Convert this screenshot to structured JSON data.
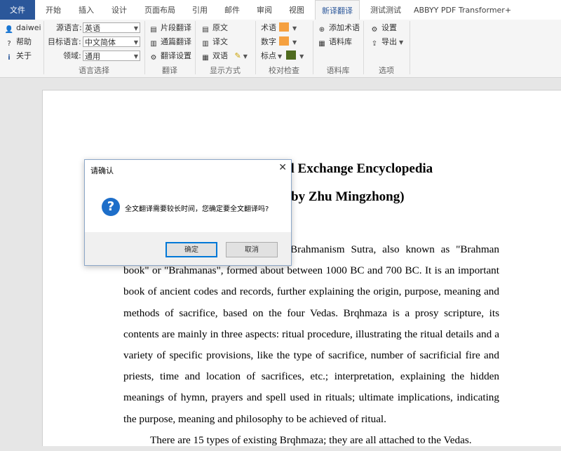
{
  "tabs": [
    {
      "label": "文件",
      "type": "file"
    },
    {
      "label": "开始"
    },
    {
      "label": "插入"
    },
    {
      "label": "设计"
    },
    {
      "label": "页面布局"
    },
    {
      "label": "引用"
    },
    {
      "label": "邮件"
    },
    {
      "label": "审阅"
    },
    {
      "label": "视图"
    },
    {
      "label": "新译翻译",
      "active": true
    },
    {
      "label": "测试测试"
    },
    {
      "label": "ABBYY PDF Transformer+"
    }
  ],
  "ribbon": {
    "account": {
      "user": "daiwei",
      "help": "帮助",
      "about": "关于"
    },
    "language": {
      "source_label": "源语言:",
      "source_value": "英语",
      "target_label": "目标语言:",
      "target_value": "中文简体",
      "domain_label": "领域:",
      "domain_value": "通用",
      "group_label": "语言选择"
    },
    "translate": {
      "segment": "片段翻译",
      "full": "通篇翻译",
      "settings": "翻译设置",
      "group_label": "翻译"
    },
    "display": {
      "original": "原文",
      "translation": "译文",
      "bilingual": "双语",
      "group_label": "显示方式"
    },
    "proof": {
      "term": "术语",
      "number": "数字",
      "punct": "标点",
      "group_label": "校对检查",
      "term_color": "#f5a040",
      "number_color": "#f5a040",
      "punct_color": "#4f6b1f"
    },
    "corpus": {
      "add_term": "添加术语",
      "corpus_lib": "语料库",
      "group_label": "语料库"
    },
    "options": {
      "settings": "设置",
      "export": "导出",
      "group_label": "选项"
    }
  },
  "document": {
    "heading1": "al Exchange Encyclopedia",
    "heading2": "by Zhu Mingzhong)",
    "para1": "Brahmanism Sutra, also known as \"Brahman book\" or \"Brahmanas\", formed about between 1000 BC and 700 BC. It is an important book of ancient codes and records, further explaining the origin, purpose, meaning and methods of sacrifice, based on the four Vedas. Brqhmaza is a prosy scripture, its contents are mainly in three aspects: ritual procedure, illustrating the ritual details and a variety of specific provisions, like the type of sacrifice, number of sacrificial fire and priests, time and location of sacrifices, etc.; interpretation, explaining the hidden meanings of hymn, prayers and spell used in rituals; ultimate implications, indicating the purpose, meaning and philosophy to be achieved of ritual.",
    "para2": "There are 15 types of existing Brqhmaza; they are all attached to the Vedas."
  },
  "dialog": {
    "title": "请确认",
    "message": "全文翻译需要较长时间，您确定要全文翻译吗?",
    "ok": "确定",
    "cancel": "取消"
  }
}
